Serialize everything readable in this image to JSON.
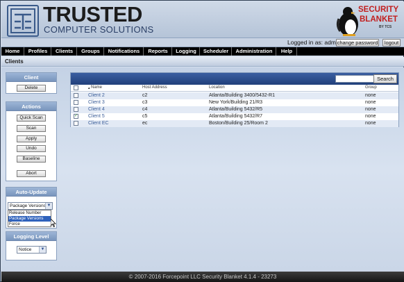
{
  "brand": {
    "title": "TRUSTED",
    "subtitle": "COMPUTER SOLUTIONS",
    "product_line1": "SECURITY",
    "product_line2": "BLANKET",
    "product_by": "BY TCS"
  },
  "userbar": {
    "logged_in_text": "Logged in as: admin",
    "change_password_label": "change password",
    "logout_label": "logout"
  },
  "nav": {
    "items": [
      {
        "label": "Home"
      },
      {
        "label": "Profiles"
      },
      {
        "label": "Clients"
      },
      {
        "label": "Groups"
      },
      {
        "label": "Notifications"
      },
      {
        "label": "Reports"
      },
      {
        "label": "Logging"
      },
      {
        "label": "Scheduler"
      },
      {
        "label": "Administration"
      },
      {
        "label": "Help"
      }
    ]
  },
  "breadcrumb": "Clients",
  "sidebar": {
    "client": {
      "title": "Client",
      "delete_label": "Delete"
    },
    "actions": {
      "title": "Actions",
      "quick_scan": "Quick Scan",
      "scan": "Scan",
      "apply": "Apply",
      "undo": "Undo",
      "baseline": "Baseline",
      "abort": "Abort"
    },
    "auto_update": {
      "title": "Auto-Update",
      "selected": "Package Versions",
      "options": [
        "Release Number",
        "Package Versions",
        "Force"
      ]
    },
    "logging_level": {
      "title": "Logging Level",
      "selected": "Notice"
    }
  },
  "search": {
    "button_label": "Search",
    "value": ""
  },
  "table": {
    "sort_indicator": "▲",
    "headers": {
      "name": "Name",
      "host": "Host Address",
      "location": "Location",
      "group": "Group"
    },
    "rows": [
      {
        "name": "Client 2",
        "host": "c2",
        "location": "Atlanta/Building 3400/5432-R1",
        "group": "none",
        "checked": false
      },
      {
        "name": "Client 3",
        "host": "c3",
        "location": "New York/Building 21/R3",
        "group": "none",
        "checked": false
      },
      {
        "name": "Client 4",
        "host": "c4",
        "location": "Atlanta/Building 5432/R5",
        "group": "none",
        "checked": false
      },
      {
        "name": "Client 5",
        "host": "c5",
        "location": "Atlanta/Building 5432/R7",
        "group": "none",
        "checked": true
      },
      {
        "name": "Client EC",
        "host": "ec",
        "location": "Boston/Building 25/Room 2",
        "group": "none",
        "checked": false
      }
    ],
    "check_mark": "✓"
  },
  "footer": "© 2007-2016 Forcepoint LLC Security Blanket 4.1.4 - 23273",
  "colors": {
    "nav_bg": "#000000",
    "panel_head": "#7895bd",
    "link": "#3a5d98",
    "brand_red": "#c21f1f"
  }
}
